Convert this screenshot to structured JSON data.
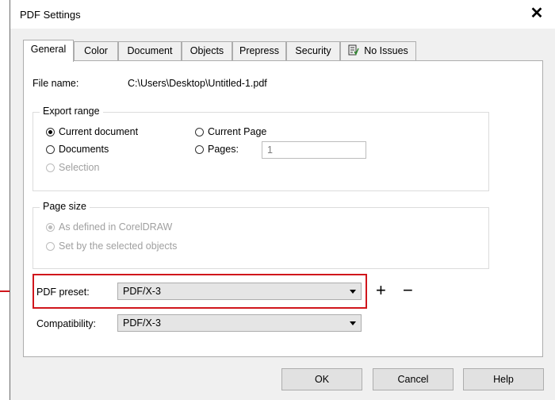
{
  "window": {
    "title": "PDF Settings"
  },
  "tabs": [
    {
      "label": "General"
    },
    {
      "label": "Color"
    },
    {
      "label": "Document"
    },
    {
      "label": "Objects"
    },
    {
      "label": "Prepress"
    },
    {
      "label": "Security"
    },
    {
      "label": "No Issues",
      "icon": "checklist-icon"
    }
  ],
  "general": {
    "file_name_label": "File name:",
    "file_name_value": "C:\\Users\\Desktop\\Untitled-1.pdf",
    "export_range": {
      "title": "Export range",
      "current_document": "Current document",
      "current_page": "Current Page",
      "documents": "Documents",
      "pages_label": "Pages:",
      "pages_value": "1",
      "selection": "Selection"
    },
    "page_size": {
      "title": "Page size",
      "as_defined": "As defined in CorelDRAW",
      "set_by_selected": "Set by the selected objects"
    },
    "pdf_preset_label": "PDF preset:",
    "pdf_preset_value": "PDF/X-3",
    "compatibility_label": "Compatibility:",
    "compatibility_value": "PDF/X-3"
  },
  "buttons": {
    "ok": "OK",
    "cancel": "Cancel",
    "help": "Help"
  },
  "colors": {
    "highlight": "#d0161c"
  }
}
